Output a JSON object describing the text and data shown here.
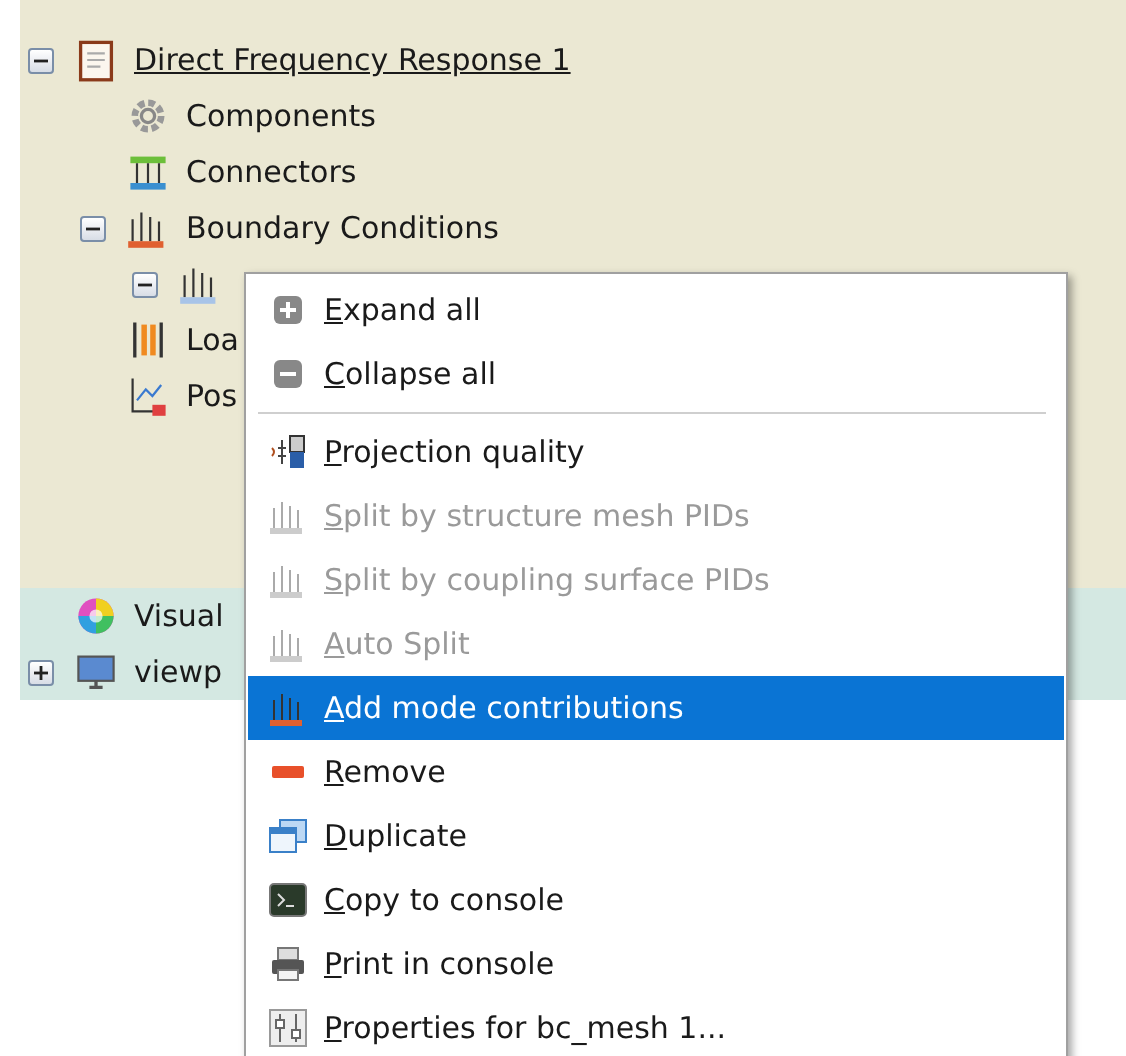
{
  "tree": [
    {
      "kind": "report",
      "label": "Direct Frequency Response 1",
      "link": true,
      "expanded": true,
      "children": [
        {
          "kind": "components",
          "label": "Components"
        },
        {
          "kind": "connectors",
          "label": "Connectors"
        },
        {
          "kind": "boundary",
          "label": "Boundary Conditions",
          "expanded": true,
          "children": [
            {
              "kind": "mesh",
              "expanded": true
            }
          ]
        },
        {
          "kind": "loads",
          "label": "Loa"
        },
        {
          "kind": "post",
          "label": "Pos"
        }
      ]
    }
  ],
  "scene_tree": [
    {
      "kind": "visual",
      "label": "Visual"
    },
    {
      "kind": "viewport",
      "label": "viewp",
      "expanded": false
    }
  ],
  "context_menu": [
    {
      "kind": "expand",
      "label": "Expand all",
      "disabled": false,
      "selected": false
    },
    {
      "kind": "collapse",
      "label": "Collapse all",
      "disabled": false,
      "selected": false
    },
    {
      "kind": "separator"
    },
    {
      "kind": "projection",
      "label": "Projection quality",
      "disabled": false,
      "selected": false
    },
    {
      "kind": "split",
      "label": "Split by structure mesh PIDs",
      "disabled": true,
      "selected": false
    },
    {
      "kind": "split",
      "label": "Split by coupling surface PIDs",
      "disabled": true,
      "selected": false
    },
    {
      "kind": "split",
      "label": "Auto Split",
      "disabled": true,
      "selected": false
    },
    {
      "kind": "add",
      "label": "Add mode contributions",
      "disabled": false,
      "selected": true
    },
    {
      "kind": "remove",
      "label": "Remove",
      "disabled": false,
      "selected": false
    },
    {
      "kind": "duplicate",
      "label": "Duplicate",
      "disabled": false,
      "selected": false
    },
    {
      "kind": "console",
      "label": "Copy to console",
      "disabled": false,
      "selected": false
    },
    {
      "kind": "print",
      "label": "Print in console",
      "disabled": false,
      "selected": false
    },
    {
      "kind": "properties",
      "label": "Properties for bc_mesh 1...",
      "disabled": false,
      "selected": false
    }
  ]
}
